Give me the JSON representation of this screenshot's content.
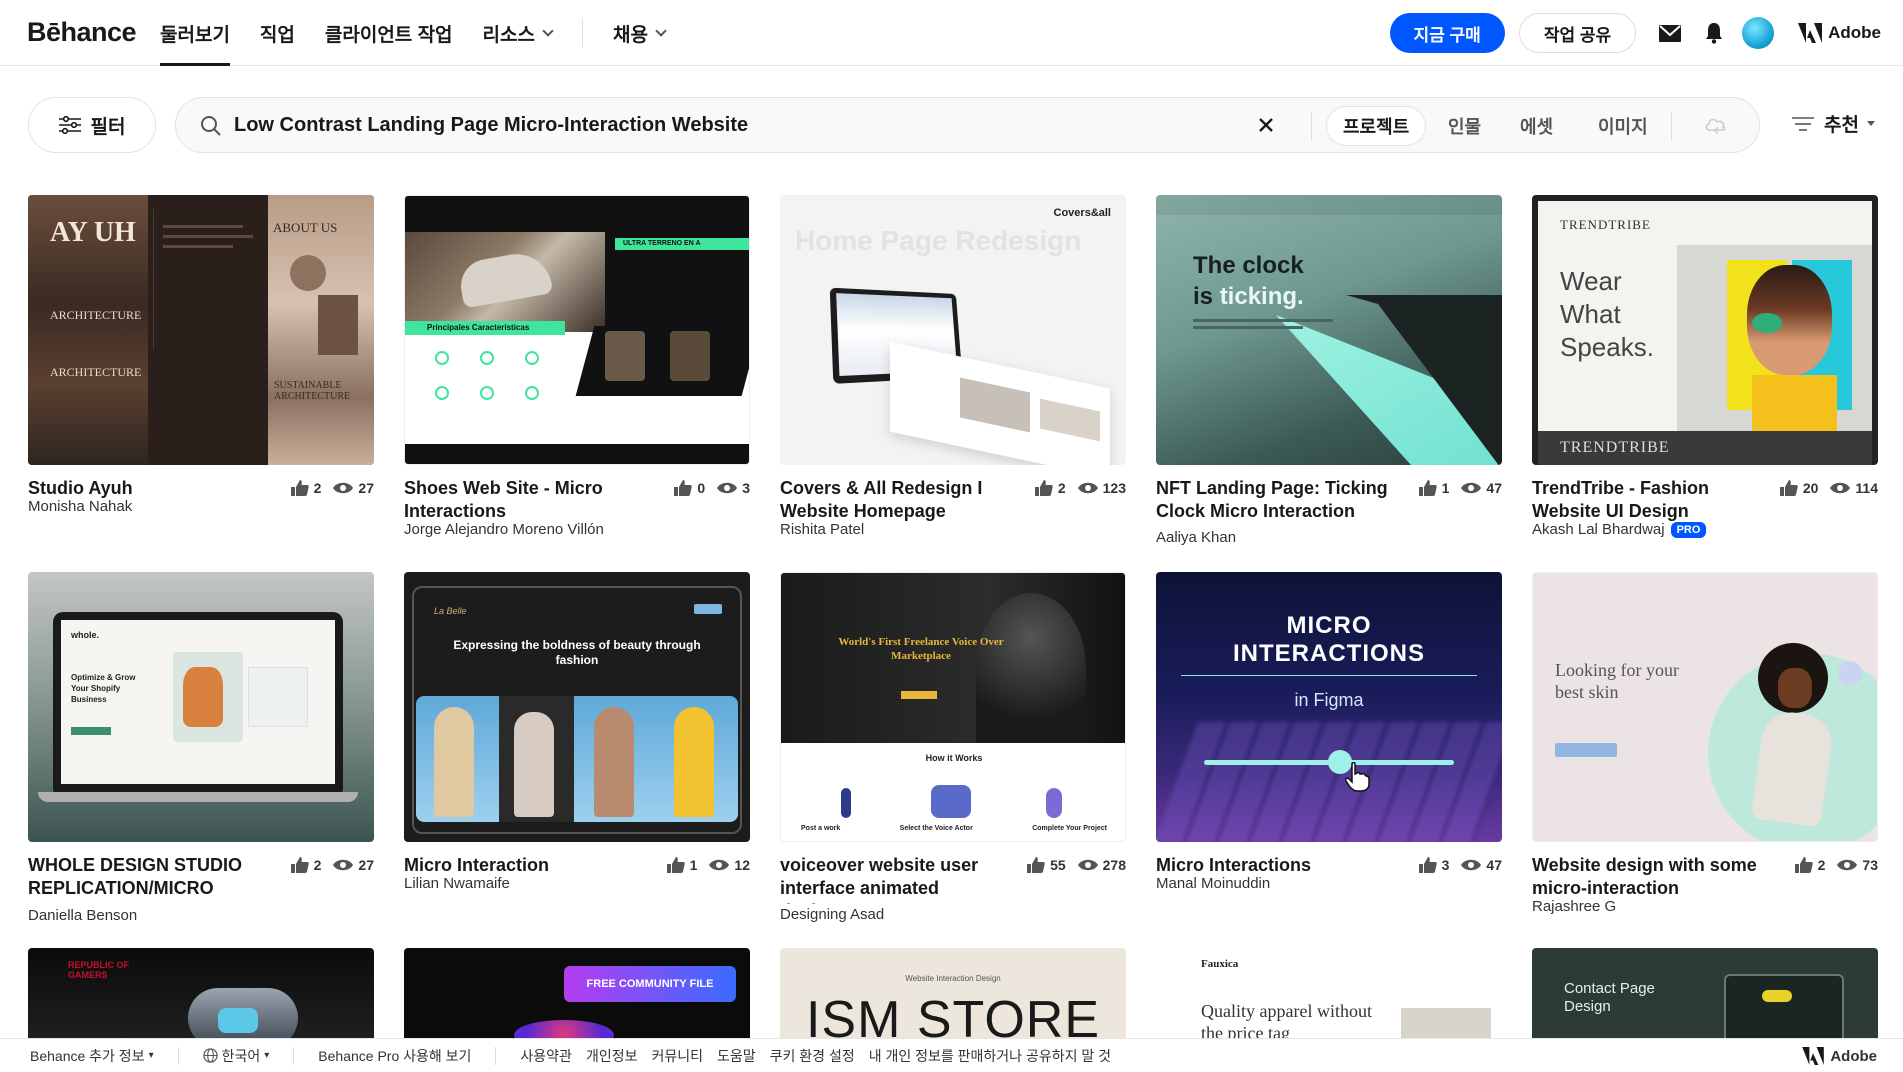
{
  "header": {
    "logo": "Bēhance",
    "nav": [
      {
        "label": "둘러보기",
        "active": true,
        "chevron": false
      },
      {
        "label": "직업",
        "active": false,
        "chevron": false
      },
      {
        "label": "클라이언트 작업",
        "active": false,
        "chevron": false
      },
      {
        "label": "리소스",
        "active": false,
        "chevron": true
      },
      {
        "label": "채용",
        "active": false,
        "chevron": true
      }
    ],
    "buy_label": "지금 구매",
    "share_label": "작업 공유",
    "adobe_label": "Adobe",
    "icons": [
      "mail-icon",
      "bell-icon",
      "avatar",
      "adobe-logo-icon"
    ]
  },
  "search": {
    "filter_label": "필터",
    "query": "Low Contrast Landing Page Micro-Interaction Website",
    "segments": [
      {
        "label": "프로젝트",
        "active": true
      },
      {
        "label": "인물",
        "active": false
      },
      {
        "label": "에셋",
        "active": false
      },
      {
        "label": "이미지",
        "active": false
      }
    ],
    "sort_label": "추천"
  },
  "projects": [
    {
      "title": "Studio Ayuh",
      "owner": "Monisha Nahak",
      "likes": "2",
      "views": "27",
      "pro": false
    },
    {
      "title": "Shoes Web Site - Micro Interactions",
      "owner": "Jorge Alejandro Moreno Villón",
      "likes": "0",
      "views": "3",
      "pro": false
    },
    {
      "title": "Covers & All Redesign I Website Homepage",
      "owner": "Rishita Patel",
      "likes": "2",
      "views": "123",
      "pro": false
    },
    {
      "title": "NFT Landing Page: Ticking Clock Micro Interaction",
      "owner": "Aaliya Khan",
      "likes": "1",
      "views": "47",
      "pro": false
    },
    {
      "title": "TrendTribe - Fashion Website UI Design",
      "owner": "Akash Lal Bhardwaj",
      "likes": "20",
      "views": "114",
      "pro": true
    },
    {
      "title": "WHOLE DESIGN STUDIO REPLICATION/MICRO",
      "owner": "Daniella Benson",
      "likes": "2",
      "views": "27",
      "pro": false
    },
    {
      "title": "Micro Interaction",
      "owner": "Lilian Nwamaife",
      "likes": "1",
      "views": "12",
      "pro": false
    },
    {
      "title": "voiceover website user interface animated design",
      "owner": "Designing Asad",
      "likes": "55",
      "views": "278",
      "pro": false
    },
    {
      "title": "Micro Interactions",
      "owner": "Manal Moinuddin",
      "likes": "3",
      "views": "47",
      "pro": false
    },
    {
      "title": "Website design with some micro-interaction",
      "owner": "Rajashree G",
      "likes": "2",
      "views": "73",
      "pro": false
    }
  ],
  "pro_badge": "PRO",
  "thumb_text": {
    "ayuh_logo": "AY UH",
    "ayuh_arch": "ARCHITECTURE",
    "ayuh_about": "ABOUT US",
    "ayuh_sustain": "SUSTAINABLE ARCHITECTURE",
    "shoes_banner": "ULTRA TERRENO EN A",
    "shoes_features": "Principales Características",
    "covers_logo": "Covers&all",
    "covers_bg": "Home Page Redesign",
    "nft_line1": "The clock",
    "nft_line2_a": "is ",
    "nft_line2_b": "ticking.",
    "tt_logo": "TRENDTRIBE",
    "tt_wear": "Wear What Speaks.",
    "whole_logo": "whole.",
    "whole_tag": "Optimize & Grow Your Shopify Business",
    "labelle_logo": "La Belle",
    "labelle_head": "Expressing the boldness of beauty through fashion",
    "voice_head": "World's First Freelance Voice Over Marketplace",
    "voice_how": "How it Works",
    "voice_steps": [
      "Post a work",
      "Select the Voice Actor",
      "Complete Your Project"
    ],
    "micro_a": "MICRO",
    "micro_b": "INTERACTIONS",
    "micro_c": "in Figma",
    "looking": "Looking for your best skin",
    "rog": "REPUBLIC OF GAMERS",
    "community": "FREE COMMUNITY FILE",
    "ism_small": "Website Interaction Design",
    "ism_big": "ISM STORE",
    "fauxica": "Fauxica",
    "quality": "Quality apparel without the price tag",
    "contact": "Contact Page Design"
  },
  "footer": {
    "more": "Behance 추가 정보",
    "language": "한국어",
    "pro": "Behance Pro 사용해 보기",
    "links": [
      "사용약관",
      "개인정보",
      "커뮤니티",
      "도움말",
      "쿠키 환경 설정",
      "내 개인 정보를 판매하거나 공유하지 말 것"
    ],
    "adobe": "Adobe"
  }
}
